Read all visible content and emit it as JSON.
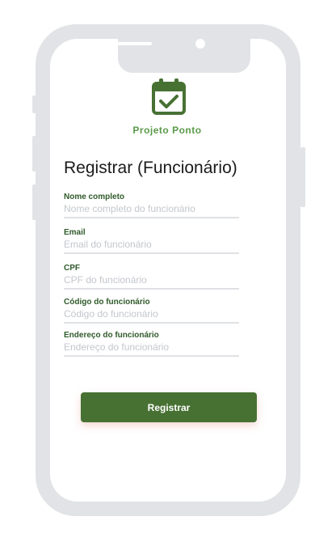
{
  "app": {
    "brand_name": "Projeto Ponto",
    "logo_icon": "calendar-check-icon",
    "accent_color": "#477133",
    "brand_color": "#5a9a4a"
  },
  "form": {
    "title": "Registrar (Funcionário)",
    "fields": [
      {
        "label": "Nome completo",
        "placeholder": "Nome completo do funcionário",
        "value": ""
      },
      {
        "label": "Email",
        "placeholder": "Email do funcionário",
        "value": ""
      },
      {
        "label": "CPF",
        "placeholder": "CPF do funcionário",
        "value": ""
      },
      {
        "label": "Código do funcionário",
        "placeholder": "Código do funcionário",
        "value": ""
      },
      {
        "label": "Endereço do funcionário",
        "placeholder": "Endereço do funcionário",
        "value": ""
      }
    ],
    "submit_label": "Registrar"
  }
}
